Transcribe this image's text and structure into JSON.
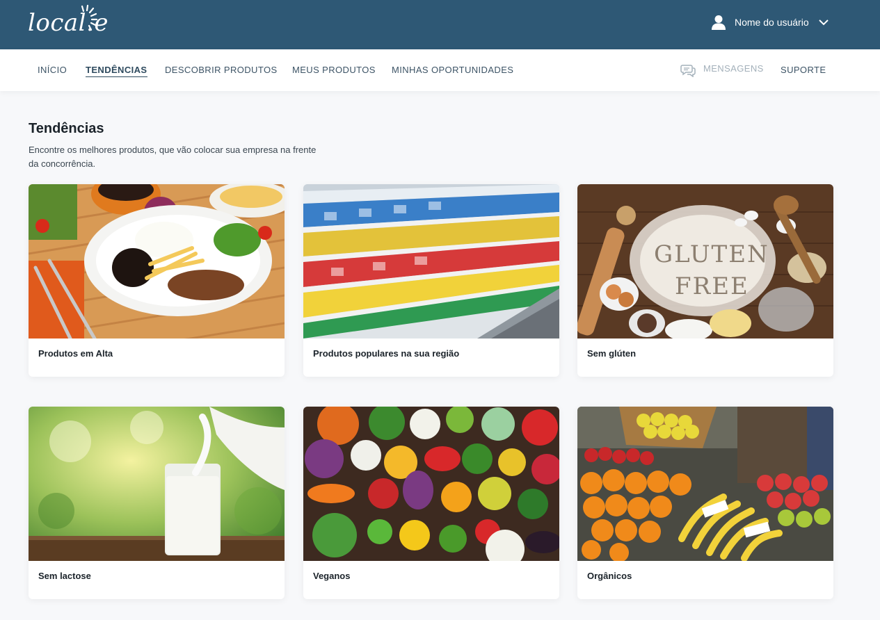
{
  "header": {
    "logo_text": "local.e",
    "user_name": "Nome do usuário"
  },
  "nav": {
    "items": [
      "INÍCIO",
      "TENDÊNCIAS",
      "DESCOBRIR PRODUTOS",
      "MEUS PRODUTOS",
      "MINHAS OPORTUNIDADES"
    ],
    "active": "TENDÊNCIAS",
    "messages": "MENSAGENS",
    "support": "SUPORTE"
  },
  "main": {
    "title": "Tendências",
    "subtitle": "Encontre os melhores produtos, que vão colocar sua empresa na frente da concorrência.",
    "cards": [
      {
        "label": "Produtos em Alta",
        "image": "food-plate-photo"
      },
      {
        "label": "Produtos populares na sua região",
        "image": "supermarket-shelf-photo"
      },
      {
        "label": "Sem glúten",
        "image": "gluten-free-flour-photo"
      },
      {
        "label": "Sem lactose",
        "image": "milk-glass-photo"
      },
      {
        "label": "Veganos",
        "image": "vegetables-photo"
      },
      {
        "label": "Orgânicos",
        "image": "fruit-stand-photo"
      }
    ]
  },
  "colors": {
    "header_bg": "#2e5875",
    "accent": "#2e4a5e"
  }
}
